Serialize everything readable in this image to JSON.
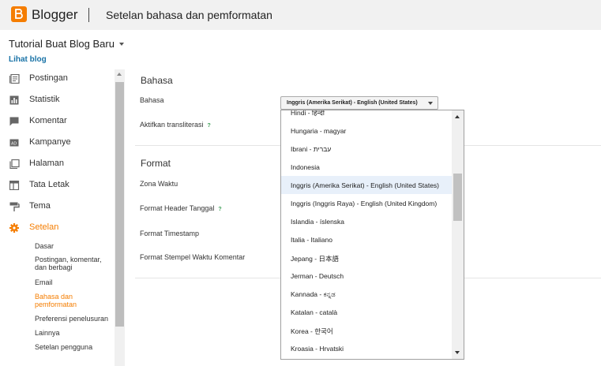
{
  "header": {
    "brand": "Blogger",
    "title": "Setelan bahasa dan pemformatan",
    "logo_color": "#f57d00"
  },
  "blog": {
    "name": "Tutorial Buat Blog Baru",
    "view_link": "Lihat blog"
  },
  "sidebar": {
    "items": [
      {
        "label": "Postingan",
        "icon": "posts-icon"
      },
      {
        "label": "Statistik",
        "icon": "stats-icon"
      },
      {
        "label": "Komentar",
        "icon": "comments-icon"
      },
      {
        "label": "Kampanye",
        "icon": "campaign-icon"
      },
      {
        "label": "Halaman",
        "icon": "pages-icon"
      },
      {
        "label": "Tata Letak",
        "icon": "layout-icon"
      },
      {
        "label": "Tema",
        "icon": "theme-icon"
      },
      {
        "label": "Setelan",
        "icon": "settings-gear-icon",
        "active": true
      }
    ],
    "subitems": [
      {
        "label": "Dasar"
      },
      {
        "label": "Postingan, komentar, dan berbagi"
      },
      {
        "label": "Email"
      },
      {
        "label": "Bahasa dan pemformatan",
        "active": true
      },
      {
        "label": "Preferensi penelusuran"
      },
      {
        "label": "Lainnya"
      },
      {
        "label": "Setelan pengguna"
      }
    ],
    "active_color": "#f57d00"
  },
  "content": {
    "section_language": "Bahasa",
    "field_language": "Bahasa",
    "field_transliteration": "Aktifkan transliterasi",
    "section_format": "Format",
    "field_timezone": "Zona Waktu",
    "field_date_header": "Format Header Tanggal",
    "field_timestamp": "Format Timestamp",
    "field_comment_timestamp": "Format Stempel Waktu Komentar",
    "help_mark": "?"
  },
  "language_select": {
    "selected": "Inggris (Amerika Serikat) - English (United States)",
    "options": [
      "Hindi - हिन्दी",
      "Hungaria - magyar",
      "Ibrani - עברית",
      "Indonesia",
      "Inggris (Amerika Serikat) - English (United States)",
      "Inggris (Inggris Raya) - English (United Kingdom)",
      "Islandia - íslenska",
      "Italia - Italiano",
      "Jepang - 日本語",
      "Jerman - Deutsch",
      "Kannada - ಕನ್ನಡ",
      "Katalan - català",
      "Korea - 한국어",
      "Kroasia - Hrvatski"
    ],
    "highlighted_index": 4
  }
}
